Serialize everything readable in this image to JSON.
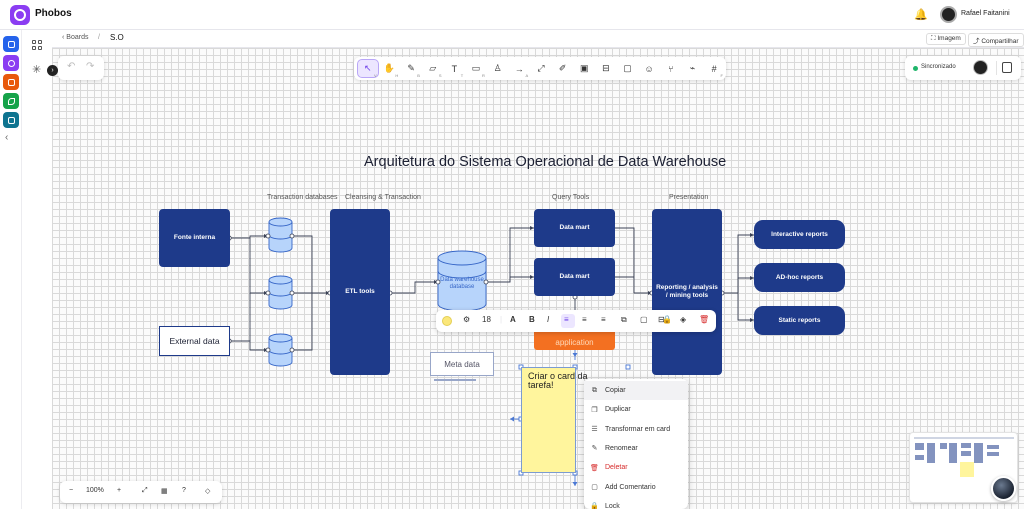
{
  "app": {
    "name": "Phobos"
  },
  "user": {
    "name": "Rafael Faitanini"
  },
  "rail": {
    "items": [
      {
        "name": "boards",
        "color": "#2563eb"
      },
      {
        "name": "phobos",
        "color": "#8b3df2"
      },
      {
        "name": "docs",
        "color": "#e8590c"
      },
      {
        "name": "whiteboard",
        "color": "#16a34a"
      },
      {
        "name": "reports",
        "color": "#0e7490"
      }
    ]
  },
  "breadcrumb": {
    "back": "Boards",
    "separator": "/",
    "current": "S.O"
  },
  "header_actions": {
    "image": "Imagem",
    "share": "Compartilhar"
  },
  "sync": {
    "status": "Sincronizado",
    "status_color": "#1fb56b"
  },
  "zoom": {
    "level": "100%",
    "minus": "−",
    "plus": "+",
    "help": "?"
  },
  "toolbar": {
    "tools": [
      {
        "icon": "cursor-icon",
        "glyph": "↖",
        "key": "V",
        "active": true
      },
      {
        "icon": "hand-icon",
        "glyph": "✋",
        "key": "H"
      },
      {
        "icon": "pen-icon",
        "glyph": "✎",
        "key": "B"
      },
      {
        "icon": "sticky-note-icon",
        "glyph": "▱",
        "key": "S"
      },
      {
        "icon": "text-icon",
        "glyph": "T",
        "key": "T"
      },
      {
        "icon": "shape-icon",
        "glyph": "▭",
        "key": "R"
      },
      {
        "icon": "person-icon",
        "glyph": "♙",
        "key": ""
      },
      {
        "icon": "arrow-icon",
        "glyph": "→",
        "key": "A"
      },
      {
        "icon": "connector-icon",
        "glyph": "⤢",
        "key": ""
      },
      {
        "icon": "marker-icon",
        "glyph": "✐",
        "key": ""
      },
      {
        "icon": "image-icon",
        "glyph": "▣",
        "key": ""
      },
      {
        "icon": "embed-icon",
        "glyph": "⊟",
        "key": ""
      },
      {
        "icon": "comment-icon",
        "glyph": "▢",
        "key": ""
      },
      {
        "icon": "emoji-icon",
        "glyph": "☺",
        "key": ""
      },
      {
        "icon": "mindmap-icon",
        "glyph": "⑂",
        "key": ""
      },
      {
        "icon": "laser-icon",
        "glyph": "⌁",
        "key": ""
      },
      {
        "icon": "frame-icon",
        "glyph": "#",
        "key": "F"
      }
    ]
  },
  "diagram": {
    "title": "Arquitetura do Sistema Operacional de Data Warehouse",
    "sections": {
      "transaction": "Transaction databases",
      "cleansing": "Cleansing & Transaction",
      "query": "Query Tools",
      "presentation": "Presentation"
    },
    "sources": {
      "internal": "Fonte interna",
      "external": "External data"
    },
    "etl": "ETL tools",
    "warehouse": "Data warehouse database",
    "marts": [
      "Data mart",
      "Data mart"
    ],
    "application_partial": "application",
    "meta": "Meta data",
    "reporting": "Reporting / analysis / mining tools",
    "outputs": [
      "Interactive reports",
      "AD-hoc reports",
      "Static reports"
    ],
    "colors": {
      "primary": "#1e3a8a",
      "orange": "#f37021",
      "sticky": "#fff59d"
    }
  },
  "sticky_note": {
    "text": "Criar o card da tarefa!"
  },
  "format_bar": {
    "font_size": "18",
    "bold": "B",
    "italic": "I",
    "text": "A"
  },
  "context_menu": {
    "items": [
      {
        "label": "Copiar",
        "icon": "copy-icon",
        "glyph": "⧉"
      },
      {
        "label": "Duplicar",
        "icon": "duplicate-icon",
        "glyph": "❐"
      },
      {
        "label": "Transformar em card",
        "icon": "card-icon",
        "glyph": "☰"
      },
      {
        "label": "Renomear",
        "icon": "rename-icon",
        "glyph": "✎"
      },
      {
        "label": "Deletar",
        "icon": "trash-icon",
        "glyph": "🗑",
        "danger": true
      },
      {
        "label": "Add Comentario",
        "icon": "comment-icon",
        "glyph": "▢"
      },
      {
        "label": "Lock",
        "icon": "lock-icon",
        "glyph": "🔒"
      }
    ]
  }
}
